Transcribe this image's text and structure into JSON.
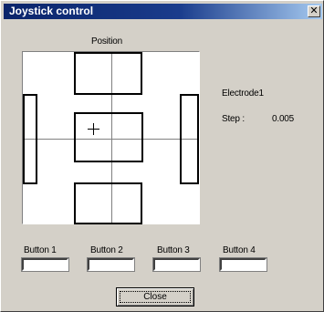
{
  "window": {
    "title": "Joystick control",
    "close_glyph": "✕"
  },
  "joystick": {
    "label": "Position"
  },
  "info": {
    "electrode": "Electrode1",
    "step_label": "Step :",
    "step_value": "0.005"
  },
  "buttons": [
    {
      "label": "Button 1",
      "value": ""
    },
    {
      "label": "Button 2",
      "value": ""
    },
    {
      "label": "Button 3",
      "value": ""
    },
    {
      "label": "Button 4",
      "value": ""
    }
  ],
  "footer": {
    "close_label": "Close"
  }
}
